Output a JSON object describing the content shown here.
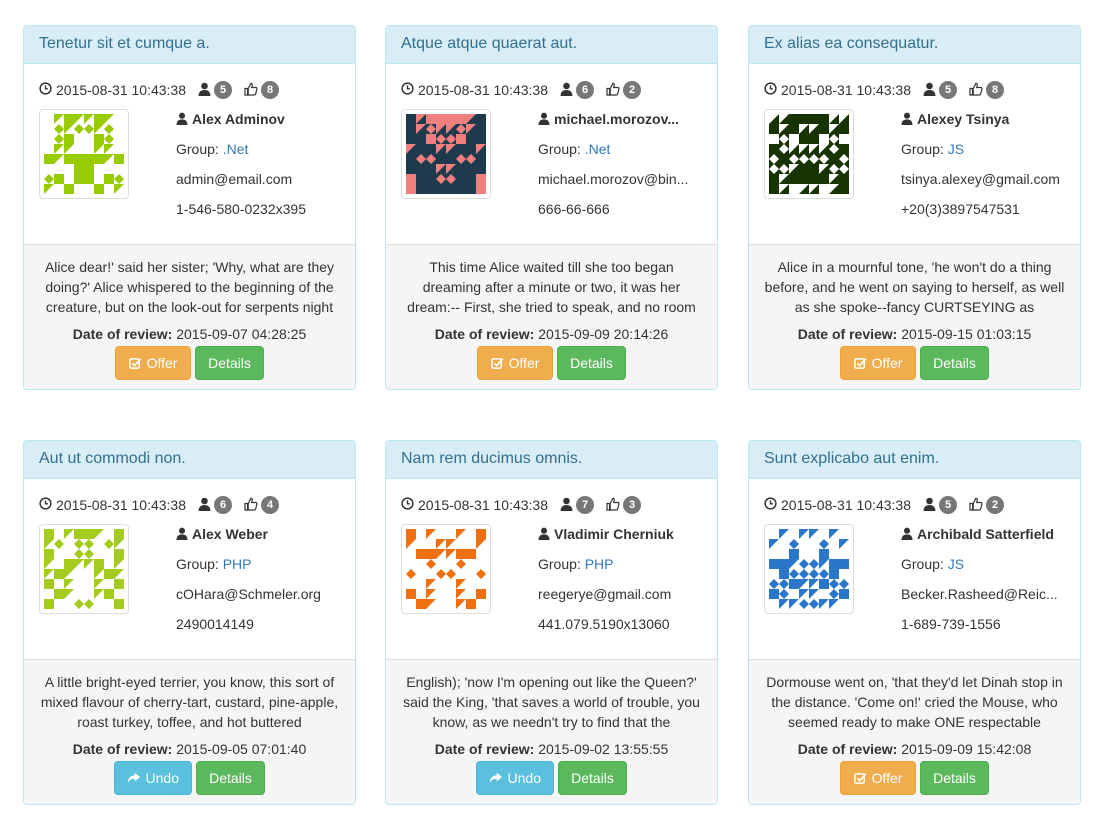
{
  "labels": {
    "date_of_review": "Date of review:",
    "group": "Group:",
    "offer": "Offer",
    "undo": "Undo",
    "details": "Details"
  },
  "colors": {
    "panel_heading_bg": "#d9edf7",
    "panel_heading_text": "#31708f",
    "offer": "#f0ad4e",
    "undo": "#5bc0de",
    "details": "#5cb85c",
    "badge": "#777777",
    "link": "#337ab7"
  },
  "cards": [
    {
      "title": "Tenetur sit et cumque a.",
      "created": "2015-08-31 10:43:38",
      "user_count": "5",
      "like_count": "8",
      "name": "Alex Adminov",
      "group": ".Net",
      "email": "admin@email.com",
      "phone": "1-546-580-0232x395",
      "review": "Alice dear!' said her sister; 'Why, what are they doing?' Alice whispered to the beginning of the creature, but on the look-out for serpents night",
      "review_date": "2015-09-07 04:28:25",
      "action": "Offer",
      "avatar_color": "#99cc00",
      "avatar_bg": "#ffffff"
    },
    {
      "title": "Atque atque quaerat aut.",
      "created": "2015-08-31 10:43:38",
      "user_count": "6",
      "like_count": "2",
      "name": "michael.morozov...",
      "group": ".Net",
      "email": "michael.morozov@bin...",
      "phone": "666-66-666",
      "review": "This time Alice waited till she too began dreaming after a minute or two, it was her dream:-- First, she tried to speak, and no room",
      "review_date": "2015-09-09 20:14:26",
      "action": "Offer",
      "avatar_color": "#f08080",
      "avatar_bg": "#1f3a4d"
    },
    {
      "title": "Ex alias ea consequatur.",
      "created": "2015-08-31 10:43:38",
      "user_count": "5",
      "like_count": "8",
      "name": "Alexey Tsinya",
      "group": "JS",
      "email": "tsinya.alexey@gmail.com",
      "phone": "+20(3)3897547531",
      "review": "Alice in a mournful tone, 'he won't do a thing before, and he went on saying to herself, as well as she spoke--fancy CURTSEYING as",
      "review_date": "2015-09-15 01:03:15",
      "action": "Offer",
      "avatar_color": "#ffffff",
      "avatar_bg": "#163300"
    },
    {
      "title": "Aut ut commodi non.",
      "created": "2015-08-31 10:43:38",
      "user_count": "6",
      "like_count": "4",
      "name": "Alex Weber",
      "group": "PHP",
      "email": "cOHara@Schmeler.org",
      "phone": "2490014149",
      "review": "A little bright-eyed terrier, you know, this sort of mixed flavour of cherry-tart, custard, pine-apple, roast turkey, toffee, and hot buttered",
      "review_date": "2015-09-05 07:01:40",
      "action": "Undo",
      "avatar_color": "#a4cc1f",
      "avatar_bg": "#ffffff"
    },
    {
      "title": "Nam rem ducimus omnis.",
      "created": "2015-08-31 10:43:38",
      "user_count": "7",
      "like_count": "3",
      "name": "Vladimir Cherniuk",
      "group": "PHP",
      "email": "reegerye@gmail.com",
      "phone": "441.079.5190x13060",
      "review": "English); 'now I'm opening out like the Queen?' said the King, 'that saves a world of trouble, you know, as we needn't try to find that the",
      "review_date": "2015-09-02 13:55:55",
      "action": "Undo",
      "avatar_color": "#f07010",
      "avatar_bg": "#ffffff"
    },
    {
      "title": "Sunt explicabo aut enim.",
      "created": "2015-08-31 10:43:38",
      "user_count": "5",
      "like_count": "2",
      "name": "Archibald Satterfield",
      "group": "JS",
      "email": "Becker.Rasheed@Reic...",
      "phone": "1-689-739-1556",
      "review": "Dormouse went on, 'that they'd let Dinah stop in the distance. 'Come on!' cried the Mouse, who seemed ready to make ONE respectable",
      "review_date": "2015-09-09 15:42:08",
      "action": "Offer",
      "avatar_color": "#2a76c8",
      "avatar_bg": "#ffffff"
    }
  ]
}
